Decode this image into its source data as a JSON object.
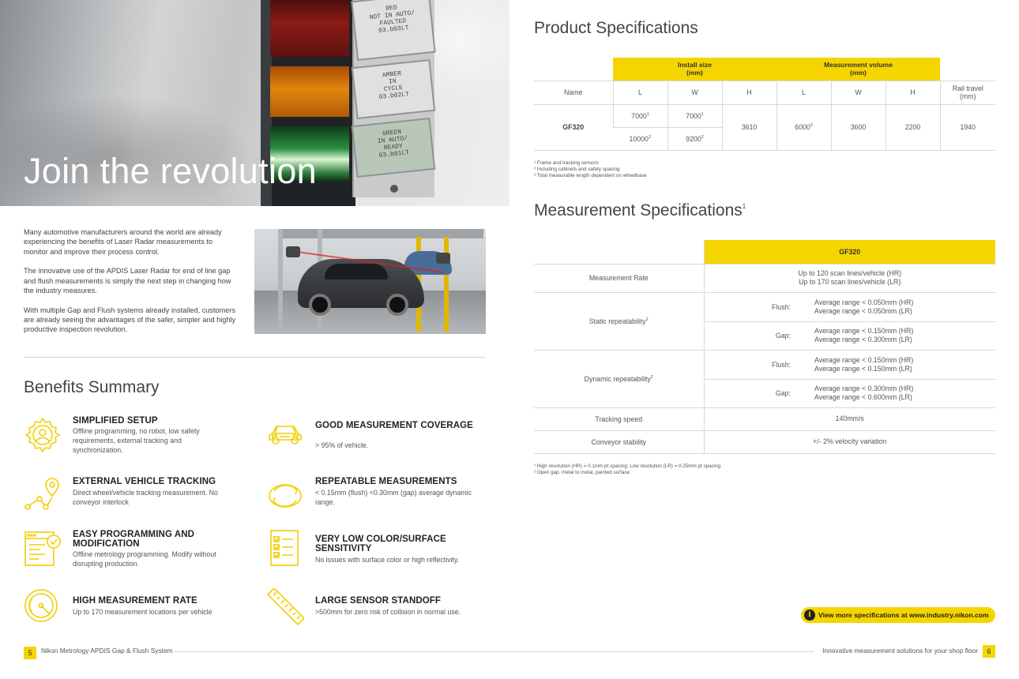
{
  "left": {
    "hero_title": "Join the revolution",
    "plates": {
      "red": [
        "RED",
        "NOT IN AUTO/",
        "FAULTED",
        "03.b03LT"
      ],
      "amber": [
        "AMBER",
        "IN",
        "CYCLE",
        "03.b02LT"
      ],
      "green": [
        "GREEN",
        "IN AUTO/",
        "READY",
        "03.b01LT"
      ]
    },
    "intro": [
      "Many automotive manufacturers around the world are already experiencing the benefits of Laser Radar measurements to monitor and improve their process control.",
      "The innovative use of the APDIS Laser Radar for end of line gap and flush measurements is simply the next step in changing how the industry measures.",
      "With multiple Gap and Flush systems already installed, customers are already seeing the advantages of the safer, simpler and highly productive inspection revolution."
    ],
    "benefits_title": "Benefits Summary",
    "benefits": [
      {
        "title": "SIMPLIFIED SETUP",
        "desc": "Offline programming, no robot, low safety requirements, external tracking and synchronization."
      },
      {
        "title": "GOOD MEASUREMENT COVERAGE",
        "desc": "> 95% of vehicle."
      },
      {
        "title": "EXTERNAL VEHICLE TRACKING",
        "desc": "Direct wheel/vehicle tracking measurement. No conveyor interlock"
      },
      {
        "title": "REPEATABLE MEASUREMENTS",
        "desc": "< 0.15mm (flush) <0.30mm (gap) average dynamic range."
      },
      {
        "title": "EASY PROGRAMMING AND MODIFICATION",
        "desc": "Offline metrology programming. Modify without disrupting production."
      },
      {
        "title": "VERY LOW COLOR/SURFACE SENSITIVITY",
        "desc": "No issues with surface color or high reflectivity."
      },
      {
        "title": "HIGH MEASUREMENT RATE",
        "desc": "Up to 170 measurement locations per vehicle"
      },
      {
        "title": "LARGE SENSOR STANDOFF",
        "desc": ">500mm for zero risk of collision in normal use."
      }
    ],
    "footer": {
      "page": "5",
      "text": "Nikon Metrology APDIS Gap & Flush System"
    }
  },
  "right": {
    "product_title": "Product Specifications",
    "product_table": {
      "install_size": "Install size",
      "measurement_volume": "Measurement volume",
      "mm": "(mm)",
      "col_name": "Name",
      "L": "L",
      "W": "W",
      "H": "H",
      "rail_travel": "Rail travel",
      "rail_unit": "(mm)",
      "row_name": "GF320",
      "install_L1": "7000",
      "install_L1_sup": "1",
      "install_W1": "7000",
      "install_W1_sup": "1",
      "install_L2": "10000",
      "install_L2_sup": "2",
      "install_W2": "9200",
      "install_W2_sup": "2",
      "install_H": "3610",
      "vol_L": "6000",
      "vol_L_sup": "3",
      "vol_W": "3600",
      "vol_H": "2200",
      "rail": "1940"
    },
    "product_footnotes": [
      "¹ Frame and tracking sensors",
      "² Including cabinets and safety spacing",
      "³ Total measurable length dependent on wheelbase"
    ],
    "meas_title": "Measurement Specifications",
    "meas_title_sup": "1",
    "meas_table": {
      "header": "GF320",
      "rate_label": "Measurement Rate",
      "rate_1": "Up to 120 scan lines/vehicle (HR)",
      "rate_2": "Up to 170 scan lines/vehicle (LR)",
      "static_label": "Static repeatability",
      "dynamic_label": "Dynamic repeatability",
      "rep_sup": "2",
      "flush": "Flush:",
      "gap": "Gap:",
      "static_flush_1": "Average range < 0.050mm (HR)",
      "static_flush_2": "Average range < 0.050mm (LR)",
      "static_gap_1": "Average range < 0.150mm (HR)",
      "static_gap_2": "Average range < 0.300mm (LR)",
      "dyn_flush_1": "Average range < 0.150mm (HR)",
      "dyn_flush_2": "Average range < 0.150mm (LR)",
      "dyn_gap_1": "Average range < 0.300mm (HR)",
      "dyn_gap_2": "Average range < 0.600mm (LR)",
      "tracking_label": "Tracking speed",
      "tracking_val": "140mm/s",
      "conveyor_label": "Conveyor stability",
      "conveyor_val": "+/- 2% velocity variation"
    },
    "meas_footnotes": [
      "¹ High resolution (HR) = 0.1mm pt spacing; Low resolution (LR) = 0.25mm pt spacing",
      "² Open gap, metal to metal, painted surface"
    ],
    "view_more": "View more specifications at www.industry.nikon.com",
    "info_glyph": "i",
    "footer": {
      "page": "6",
      "text": "Innovative measurement solutions for your shop floor"
    }
  },
  "colors": {
    "accent": "#f5d500",
    "text": "#444444",
    "icon": "#f2cf00"
  }
}
